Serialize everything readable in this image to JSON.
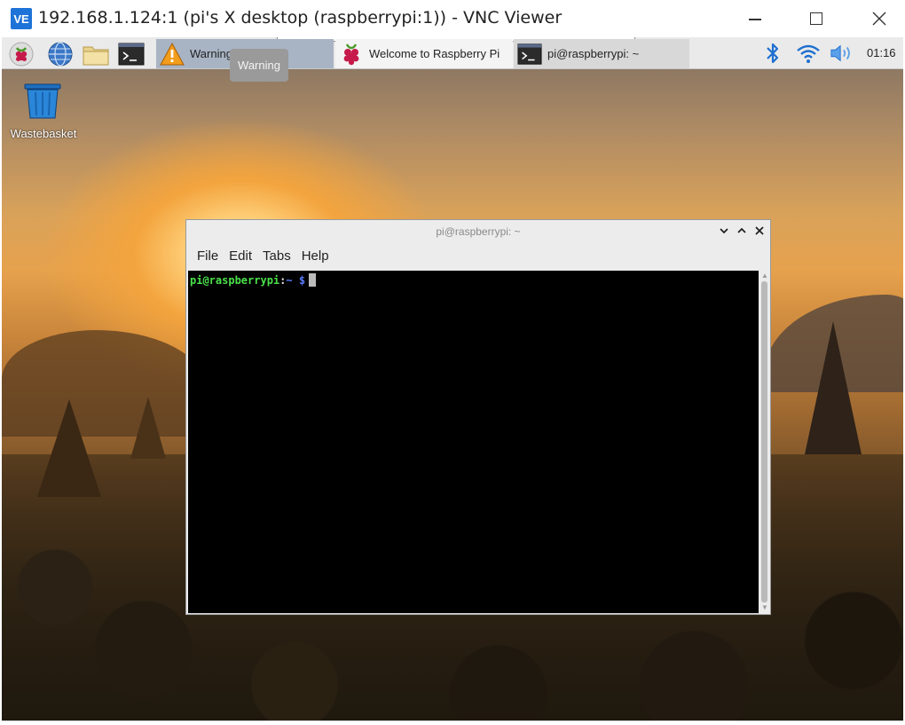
{
  "vnc": {
    "logo": "VE",
    "title": "192.168.1.124:1 (pi's X desktop (raspberrypi:1)) - VNC Viewer",
    "icons": {
      "minimize": "minimize-icon",
      "maximize": "maximize-icon",
      "close": "close-icon"
    }
  },
  "panel": {
    "launchers": [
      "raspberry-menu-icon",
      "web-browser-icon",
      "file-manager-icon",
      "terminal-icon"
    ],
    "tasks": [
      {
        "label": "Warning",
        "icon": "warning-icon"
      },
      {
        "label": "Welcome to Raspberry Pi",
        "icon": "raspberry-icon"
      },
      {
        "label": "pi@raspberrypi: ~",
        "icon": "terminal-icon"
      }
    ],
    "tooltip": "Warning",
    "tray": [
      "bluetooth-icon",
      "wifi-icon",
      "volume-icon"
    ],
    "clock": "01:16"
  },
  "desktop": {
    "wastebasket_label": "Wastebasket"
  },
  "terminal": {
    "title": "pi@raspberrypi: ~",
    "menu": [
      "File",
      "Edit",
      "Tabs",
      "Help"
    ],
    "prompt_user": "pi@raspberrypi",
    "prompt_colon": ":",
    "prompt_path": "~",
    "prompt_dollar": "$",
    "colors": {
      "user": "#4ae04a",
      "path": "#5a7dff",
      "background": "#000000"
    }
  }
}
